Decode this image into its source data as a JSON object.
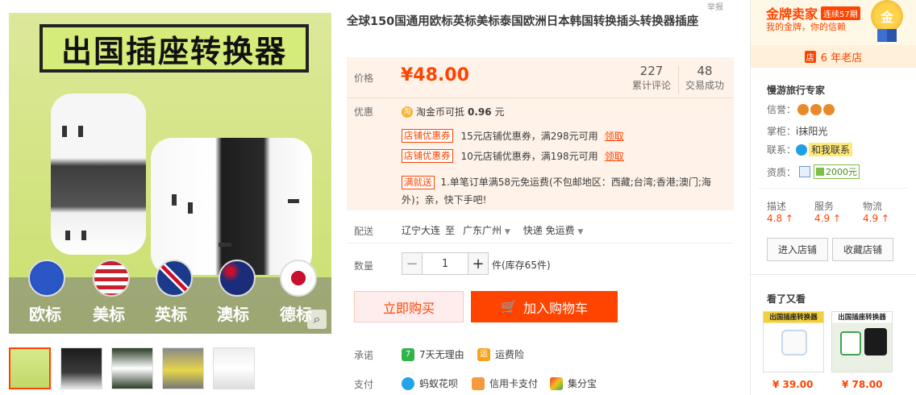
{
  "top_mark": "举报",
  "product": {
    "title": "全球150国通用欧标英标美标泰国欧洲日本韩国转换插头转换器插座",
    "main_image_banner": "出国插座转换器",
    "flag_labels": [
      "欧标",
      "美标",
      "英标",
      "澳标",
      "德标"
    ]
  },
  "price": {
    "label": "价格",
    "value": "¥48.00",
    "reviews_count": "227",
    "reviews_label": "累计评论",
    "sales_count": "48",
    "sales_label": "交易成功"
  },
  "promo": {
    "label": "优惠",
    "taojinbi_icon": "淘",
    "taojinbi_prefix": "淘金币可抵",
    "taojinbi_amount": "0.96",
    "taojinbi_suffix": "元",
    "coupons": [
      {
        "tag": "店铺优惠券",
        "text": "15元店铺优惠券，满298元可用",
        "link": "领取"
      },
      {
        "tag": "店铺优惠券",
        "text": "10元店铺优惠券，满198元可用",
        "link": "领取"
      }
    ],
    "shipping_tag": "满就送",
    "shipping_line1": "1.单笔订单满58元免运费(不包邮地区：西藏;台湾;香港;澳门;海",
    "shipping_line2": "外)；亲，快下手吧!"
  },
  "delivery": {
    "label": "配送",
    "from": "辽宁大连",
    "to_word": "至",
    "dest": "广东广州",
    "express": "快递 免运费"
  },
  "quantity": {
    "label": "数量",
    "minus": "−",
    "value": "1",
    "plus": "+",
    "unit": "件(库存65件)"
  },
  "actions": {
    "buy_now": "立即购买",
    "add_to_cart": "加入购物车"
  },
  "guarantee": {
    "label": "承诺",
    "items": [
      "7天无理由",
      "运费险"
    ],
    "icons": [
      "7",
      "运"
    ]
  },
  "payment": {
    "label": "支付",
    "items": [
      "蚂蚁花呗",
      "信用卡支付",
      "集分宝"
    ]
  },
  "seller": {
    "badge_title": "金牌卖家",
    "badge_years": "连续57期",
    "badge_sub": "我的金牌，你的信赖",
    "medal_text": "金",
    "since": "6 年老店",
    "since_icon": "店",
    "shop_name": "慢游旅行专家",
    "credit_label": "信誉：",
    "keeper_label": "掌柜：",
    "keeper_name": "i抹阳光",
    "contact_label": "联系：",
    "contact_button": "和我联系",
    "qual_label": "资质：",
    "qual_amount": "2000元",
    "scores": [
      {
        "name": "描述",
        "value": "4.8"
      },
      {
        "name": "服务",
        "value": "4.9"
      },
      {
        "name": "物流",
        "value": "4.9"
      }
    ],
    "enter_shop": "进入店铺",
    "fav_shop": "收藏店铺"
  },
  "recommend": {
    "heading": "看了又看",
    "items": [
      {
        "banner": "出国插座转换器",
        "price": "¥ 39.00"
      },
      {
        "banner": "出国插座转换器",
        "price": "¥ 78.00"
      }
    ]
  },
  "colors": {
    "accent": "#ff4400",
    "promo_bg": "#fff2e8"
  }
}
